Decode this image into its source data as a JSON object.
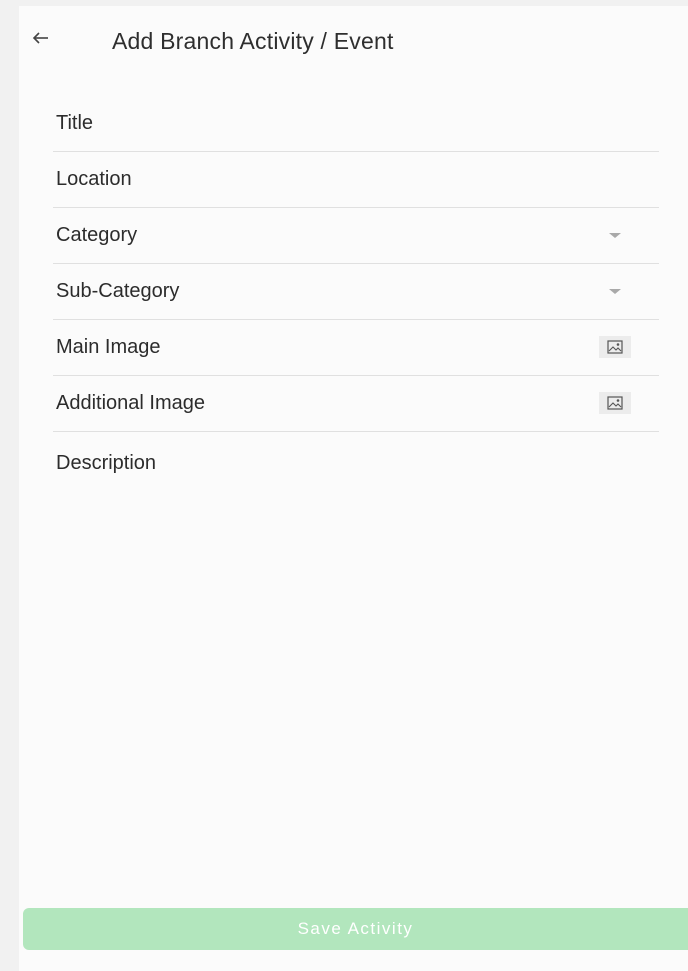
{
  "header": {
    "back_icon": "arrow-left-icon",
    "title": "Add Branch Activity / Event"
  },
  "form": {
    "title_label": "Title",
    "location_label": "Location",
    "category_label": "Category",
    "sub_category_label": "Sub-Category",
    "main_image_label": "Main Image",
    "additional_image_label": "Additional Image",
    "description_label": "Description",
    "dropdown_icon": "caret-down-icon",
    "image_icon": "image-picker-icon"
  },
  "footer": {
    "save_label": "Save Activity"
  },
  "colors": {
    "background": "#fbfbfb",
    "divider": "#e0e0e0",
    "save_button_disabled": "#b2e6bd",
    "text": "#2c2c2c"
  }
}
